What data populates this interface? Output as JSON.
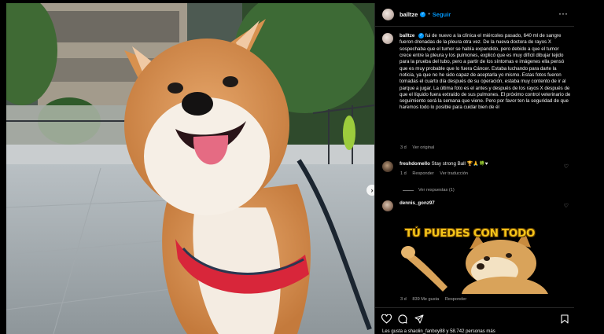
{
  "post": {
    "username": "balltze",
    "follow_label": "Seguir",
    "caption_username": "balltze",
    "caption": "fui de nuevo a la clínica el miércoles pasado, 640 ml de sangre fueron drenadas de la pleura otra vez. De la nueva doctora de rayos X sospechaba que el tumor se había expandido, pero debido a que el tumor crece entre la pleura y los pulmones, explicó que es muy difícil dibujar tejido para la prueba del tubo, pero a partir de los síntomas e imágenes ella pensó que es muy probable que lo fuera Cáncer. Estaba luchando para darte la noticia, ya que no he sido capaz de aceptarla yo mismo. Estas fotos fueron tomadas el cuarto día después de su operación, estaba muy contento de ir al parque a jugar. La última foto es el antes y después de los rayos X después de que el líquido fuera extraído de sus pulmones. El próximo control veterinario de seguimiento será la semana que viene. Pero por favor ten la seguridad de que haremos todo lo posible para cuidar bien de él",
    "caption_time": "3 d",
    "see_original": "Ver original"
  },
  "comments": [
    {
      "username": "freshdomello",
      "text": "Stay strong Ball 🏆🙏🍀♥",
      "time": "1 d",
      "reply": "Responder",
      "translate": "Ver traducción",
      "view_replies": "Ver respuestas (1)"
    },
    {
      "username": "dennis_gonz97",
      "sticker_text": "TÚ PUEDES CON TODO",
      "time": "3 d",
      "likes": "839 Me gusta",
      "reply": "Responder"
    }
  ],
  "footer": {
    "likes_line": "Les gusta a shaolin_fanboy88 y 58.742 personas más"
  },
  "icons": {
    "more": "more-horizontal-icon",
    "heart": "heart-icon",
    "comment": "comment-icon",
    "share": "share-icon",
    "save": "bookmark-icon",
    "next": "chevron-right-icon"
  },
  "colors": {
    "accent": "#0095f6",
    "background": "#000000",
    "harness": "#d8263a"
  }
}
